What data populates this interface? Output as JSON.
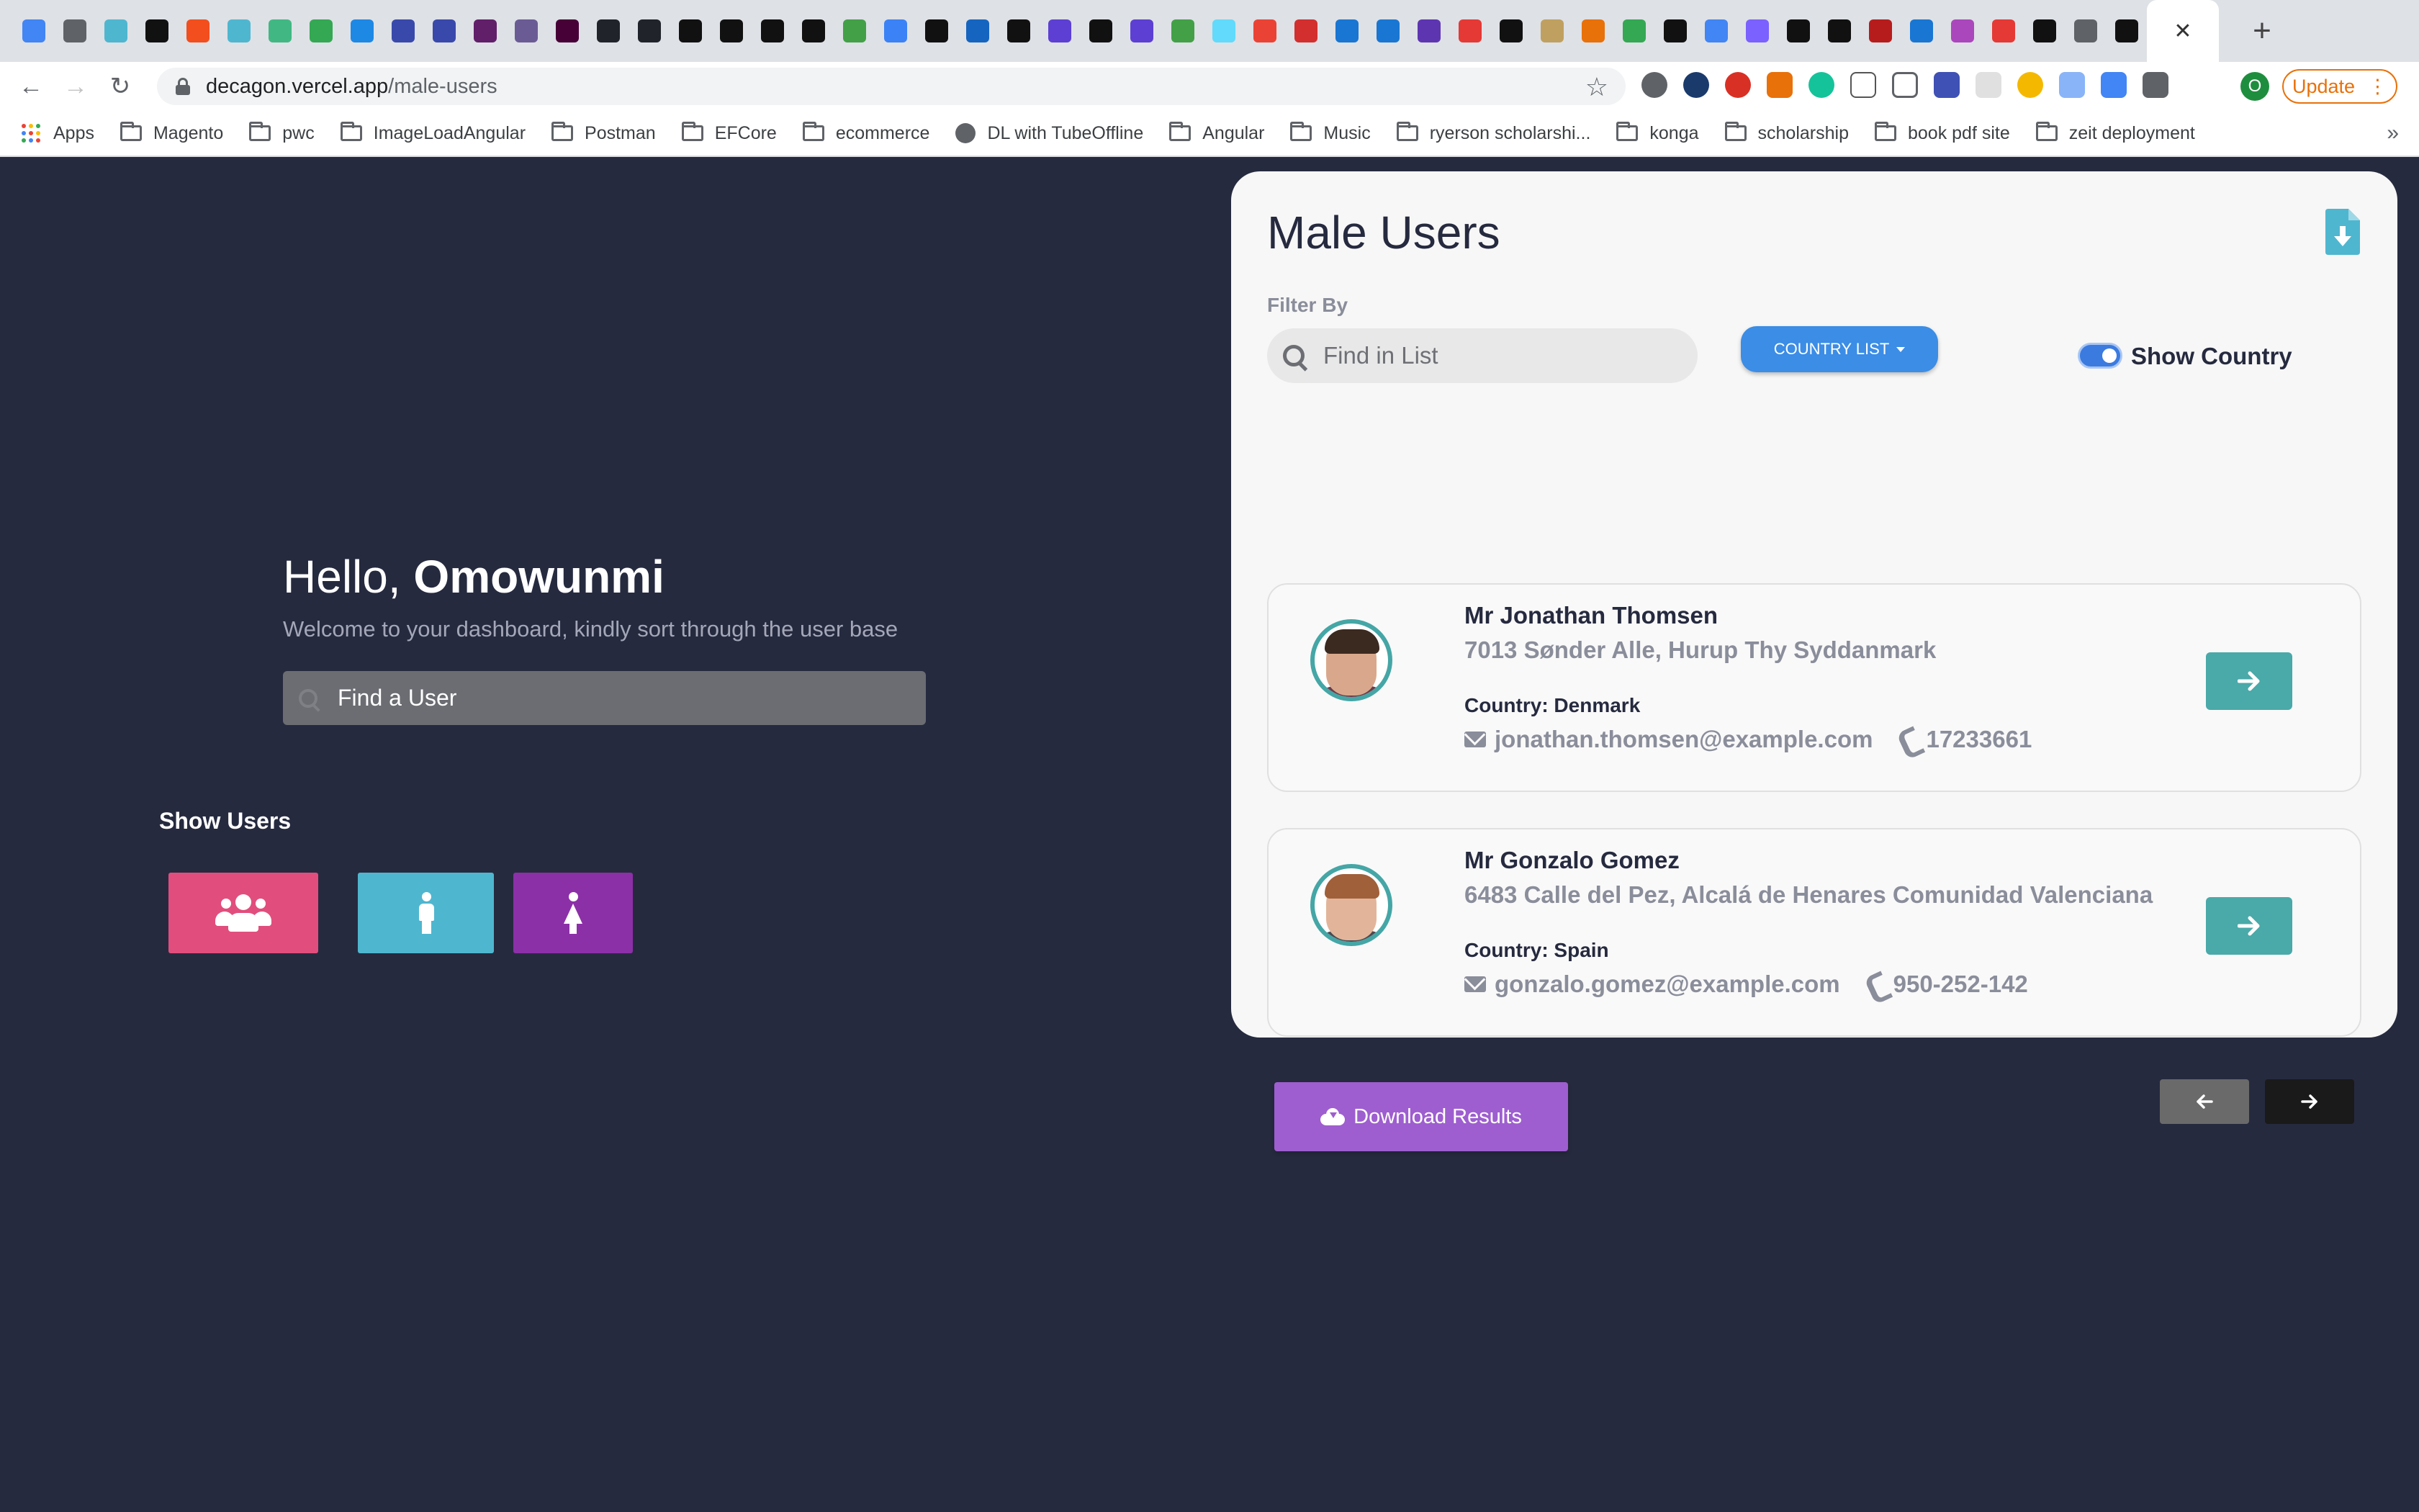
{
  "browser": {
    "url_host": "decagon.vercel.app",
    "url_path": "/male-users",
    "update_label": "Update",
    "profile_initial": "O",
    "bookmarks": [
      {
        "label": "Apps",
        "icon": "apps-icon"
      },
      {
        "label": "Magento",
        "icon": "folder-icon"
      },
      {
        "label": "pwc",
        "icon": "folder-icon"
      },
      {
        "label": "ImageLoadAngular",
        "icon": "folder-icon"
      },
      {
        "label": "Postman",
        "icon": "folder-icon"
      },
      {
        "label": "EFCore",
        "icon": "folder-icon"
      },
      {
        "label": "ecommerce",
        "icon": "folder-icon"
      },
      {
        "label": "DL with TubeOffline",
        "icon": "globe-icon"
      },
      {
        "label": "Angular",
        "icon": "folder-icon"
      },
      {
        "label": "Music",
        "icon": "folder-icon"
      },
      {
        "label": "ryerson scholarshi...",
        "icon": "folder-icon"
      },
      {
        "label": "konga",
        "icon": "folder-icon"
      },
      {
        "label": "scholarship",
        "icon": "folder-icon"
      },
      {
        "label": "book pdf site",
        "icon": "folder-icon"
      },
      {
        "label": "zeit deployment",
        "icon": "folder-icon"
      }
    ],
    "bookmarks_more": "»"
  },
  "dashboard": {
    "greeting_prefix": "Hello, ",
    "user_name": "Omowunmi",
    "welcome": "Welcome to your dashboard, kindly sort through the user base",
    "search_placeholder": "Find a User",
    "show_users_label": "Show Users",
    "buttons": {
      "all_color": "#e14e7d",
      "male_color": "#4fb6cf",
      "female_color": "#8c30a8"
    }
  },
  "panel": {
    "title": "Male Users",
    "filter_label": "Filter By",
    "search_placeholder": "Find in List",
    "country_list_label": "COUNTRY LIST",
    "show_country_label": "Show Country",
    "show_country_on": true,
    "download_label": "Download Results",
    "users": [
      {
        "name": "Mr Jonathan Thomsen",
        "address": "7013 Sønder Alle, Hurup Thy Syddanmark",
        "country": "Country: Denmark",
        "email": "jonathan.thomsen@example.com",
        "phone": "17233661"
      },
      {
        "name": "Mr Gonzalo Gomez",
        "address": "6483 Calle del Pez, Alcalá de Henares Comunidad Valenciana",
        "country": "Country: Spain",
        "email": "gonzalo.gomez@example.com",
        "phone": "950-252-142"
      }
    ]
  }
}
